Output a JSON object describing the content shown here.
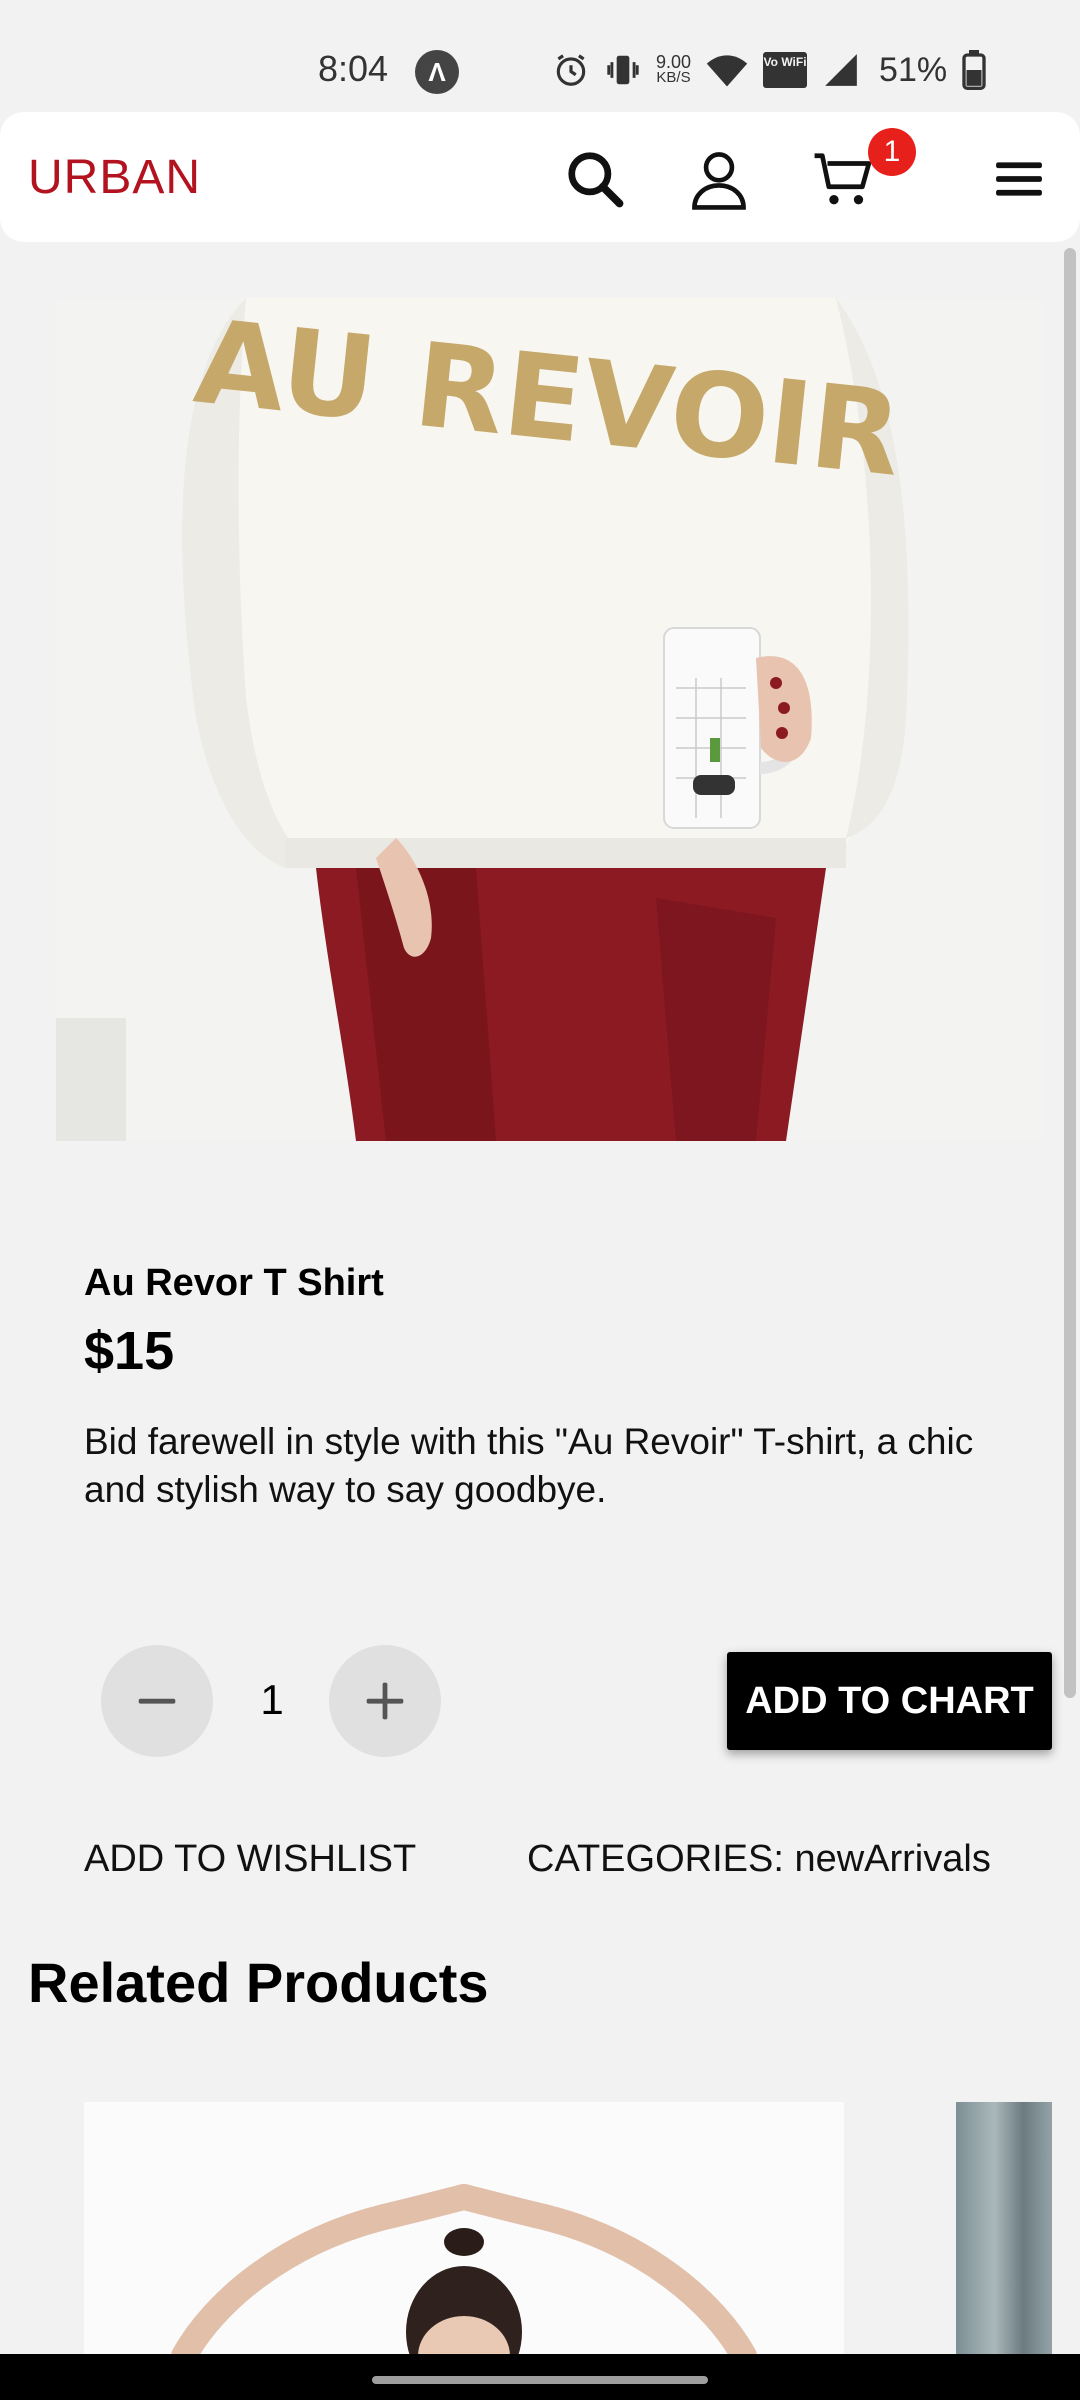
{
  "status_bar": {
    "time": "8:04",
    "app_badge": "Λ",
    "net_speed_value": "9.00",
    "net_speed_unit": "KB/S",
    "wifi_label": "Vo WiFi",
    "battery": "51%"
  },
  "header": {
    "logo": "URBAN",
    "cart_count": "1",
    "accent_color": "#b3121f"
  },
  "product": {
    "name": "Au Revor T Shirt",
    "price": "$15",
    "description": "Bid farewell in style with this \"Au Revoir\" T-shirt, a chic and stylish way to say goodbye.",
    "image_text": "AU REVOIR",
    "quantity": "1",
    "add_button": "ADD TO CHART",
    "wishlist": "ADD TO WISHLIST",
    "categories": "CATEGORIES: newArrivals"
  },
  "related": {
    "title": "Related Products"
  },
  "icons": {
    "search": "search-icon",
    "user": "user-icon",
    "cart": "cart-icon",
    "menu": "menu-icon",
    "minus": "minus-icon",
    "plus": "plus-icon"
  }
}
